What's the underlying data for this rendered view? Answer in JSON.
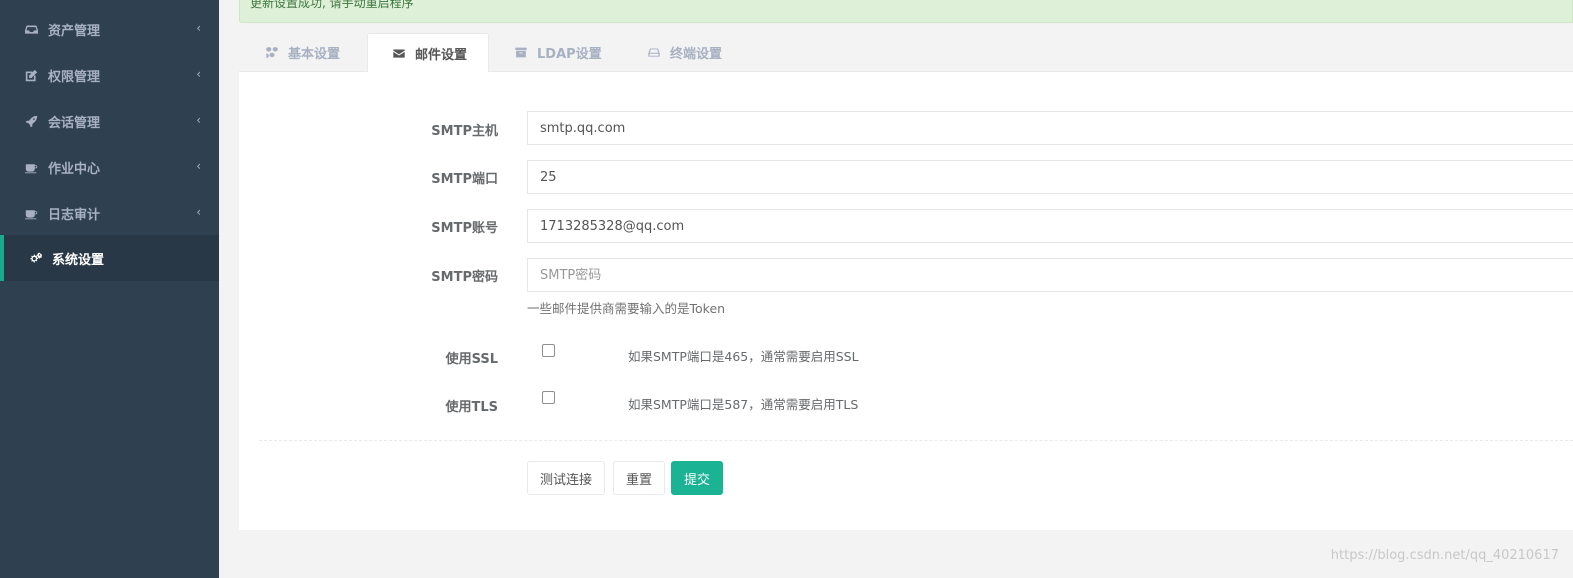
{
  "sidebar": {
    "items": [
      {
        "label": "资产管理",
        "icon": "inbox-icon",
        "arrow": "‹"
      },
      {
        "label": "权限管理",
        "icon": "edit-icon",
        "arrow": "‹"
      },
      {
        "label": "会话管理",
        "icon": "rocket-icon",
        "arrow": "‹"
      },
      {
        "label": "作业中心",
        "icon": "coffee-icon",
        "arrow": "‹"
      },
      {
        "label": "日志审计",
        "icon": "coffee-icon",
        "arrow": "‹"
      },
      {
        "label": "系统设置",
        "icon": "gears-icon",
        "active": true
      }
    ]
  },
  "alert": {
    "text": "更新设置成功, 请手动重启程序"
  },
  "tabs": [
    {
      "label": "基本设置",
      "icon": "cubes-icon"
    },
    {
      "label": "邮件设置",
      "icon": "envelope-icon",
      "active": true
    },
    {
      "label": "LDAP设置",
      "icon": "archive-icon"
    },
    {
      "label": "终端设置",
      "icon": "hdd-icon"
    }
  ],
  "form": {
    "smtp_host": {
      "label": "SMTP主机",
      "value": "smtp.qq.com"
    },
    "smtp_port": {
      "label": "SMTP端口",
      "value": "25"
    },
    "smtp_user": {
      "label": "SMTP账号",
      "value": "1713285328@qq.com"
    },
    "smtp_password": {
      "label": "SMTP密码",
      "placeholder": "SMTP密码",
      "help": "一些邮件提供商需要输入的是Token"
    },
    "use_ssl": {
      "label": "使用SSL",
      "checked": false,
      "help": "如果SMTP端口是465，通常需要启用SSL"
    },
    "use_tls": {
      "label": "使用TLS",
      "checked": false,
      "help": "如果SMTP端口是587，通常需要启用TLS"
    }
  },
  "buttons": {
    "test": "测试连接",
    "reset": "重置",
    "submit": "提交"
  },
  "colors": {
    "sidebar": "#2f4050",
    "accent": "#1ab394",
    "alert_bg": "#dff0d8"
  },
  "watermark": "https://blog.csdn.net/qq_40210617"
}
